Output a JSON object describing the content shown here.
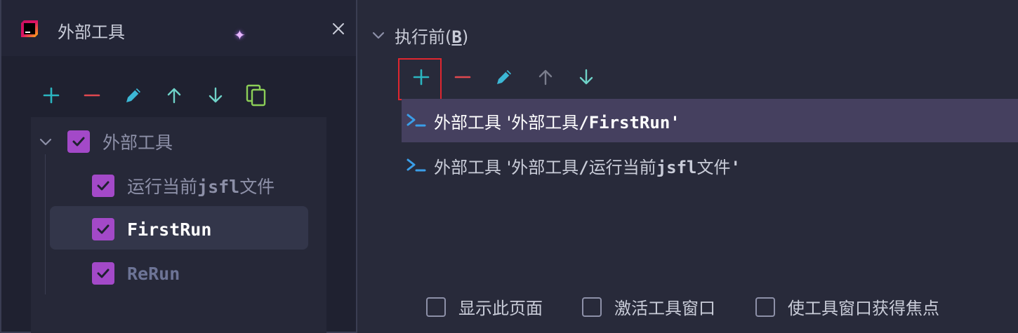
{
  "window": {
    "title": "外部工具",
    "close_label": "×"
  },
  "toolbar_left": {
    "icons": [
      "plus-icon",
      "minus-icon",
      "edit-icon",
      "arrow-up-icon",
      "arrow-down-icon",
      "copy-icon"
    ]
  },
  "tree": {
    "root": {
      "label": "外部工具",
      "checked": true,
      "expanded": true
    },
    "children": [
      {
        "label_prefix": "运行当前",
        "label_code": "jsfl",
        "label_suffix": "文件",
        "checked": true
      },
      {
        "label": "FirstRun",
        "checked": true,
        "selected": true
      },
      {
        "label": "ReRun",
        "checked": true
      }
    ]
  },
  "before_launch": {
    "section_title": "执行前(",
    "section_mnemonic": "B",
    "section_close": ")",
    "toolbar_icons": [
      "plus-icon",
      "minus-icon",
      "edit-icon",
      "arrow-up-icon",
      "arrow-down-icon"
    ],
    "tasks": [
      {
        "prefix": "外部工具 '外部工具",
        "slash": "/",
        "name": "FirstRun",
        "suffix": "'",
        "selected": true
      },
      {
        "prefix": "外部工具 '外部工具",
        "slash": "/",
        "name_prefix": "运行当前",
        "name_code": "jsfl",
        "name_suffix": "文件",
        "suffix": "'",
        "selected": false
      }
    ]
  },
  "options": [
    {
      "label": "显示此页面",
      "checked": false
    },
    {
      "label": "激活工具窗口",
      "checked": false
    },
    {
      "label": "使工具窗口获得焦点",
      "checked": false
    }
  ],
  "colors": {
    "accent_plus": "#2bb5c0",
    "accent_minus": "#e0484f",
    "checkbox": "#a349c8",
    "selection": "#45405f",
    "highlight_box": "#e0262f"
  }
}
